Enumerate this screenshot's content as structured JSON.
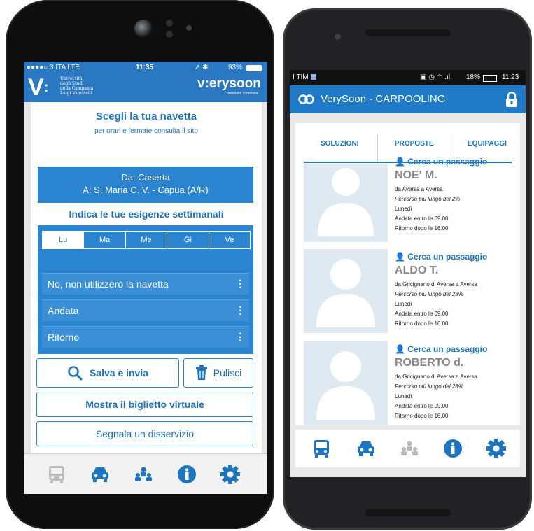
{
  "left_phone": {
    "status": {
      "carrier": "●●●●○ 3 ITA  LTE",
      "time": "11:35",
      "battery": "93%"
    },
    "header": {
      "univ_lines": [
        "Università",
        "degli Studi",
        "della Campania",
        "Luigi Vanvitelli"
      ],
      "brand": "v:erysoon",
      "brand_sub": "università connessa"
    },
    "title": "Scegli la tua navetta",
    "subtitle": "per orari e fermate consulta il sito",
    "route": {
      "from": "Da: Caserta",
      "to": "A: S. Maria C. V. - Capua (A/R)"
    },
    "needs_label": "Indica le tue esigenze settimanali",
    "days": [
      "Lu",
      "Ma",
      "Me",
      "Gi",
      "Ve"
    ],
    "selected_day": "Lu",
    "options": [
      "No, non utilizzerò la navetta",
      "Andata",
      "Ritorno"
    ],
    "buttons": {
      "save": "Salva e invia",
      "clear": "Pulisci",
      "ticket": "Mostra il biglietto virtuale",
      "report": "Segnala un disservizio"
    },
    "nav_icons": [
      "bus-icon",
      "car-icon",
      "group-icon",
      "info-icon",
      "settings-icon"
    ]
  },
  "right_phone": {
    "status": {
      "carrier": "I TIM",
      "battery": "18%",
      "time": "11:23"
    },
    "app_title": "VerySoon - CARPOOLING",
    "tabs": [
      "SOLUZIONI",
      "PROPOSTE",
      "EQUIPAGGI"
    ],
    "results": [
      {
        "action": "Cerca un passaggio",
        "name": "NOE' M.",
        "route": "da Aversa a Aversa",
        "extra": "Percorso più lungo del 2%",
        "day": "Lunedì",
        "out": "Andata entro le 09.00",
        "back": "Ritorno dopo le 16.00"
      },
      {
        "action": "Cerca un passaggio",
        "name": "ALDO T.",
        "route": "da Gricignano di Aversa a Aversa",
        "extra": "Percorso più lungo del 28%",
        "day": "Lunedì",
        "out": "Andata entro le 09.00",
        "back": "Ritorno dopo le 16.00"
      },
      {
        "action": "Cerca un passaggio",
        "name": "ROBERTO d.",
        "route": "da Gricignano di Aversa a Aversa",
        "extra": "Percorso più lungo del 28%",
        "day": "Lunedì",
        "out": "Andata entro le 09.00",
        "back": "Ritorno dopo le 16.00"
      }
    ],
    "nav_icons": [
      "bus-icon",
      "car-icon",
      "group-icon",
      "info-icon",
      "settings-icon"
    ],
    "system_nav": [
      "back-icon",
      "home-icon",
      "recents-icon"
    ]
  },
  "colors": {
    "primary": "#2b78c2",
    "accent": "#1d74c1",
    "panel": "#2b84d0"
  }
}
